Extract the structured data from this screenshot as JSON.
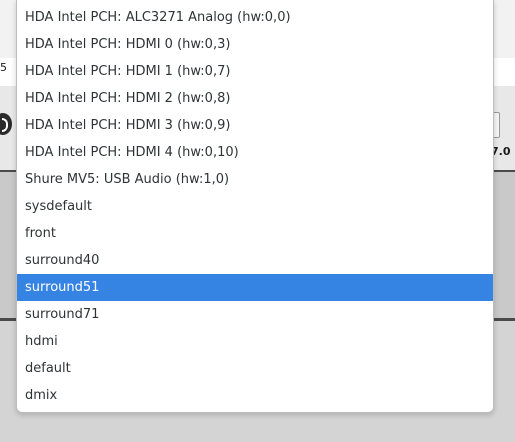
{
  "background": {
    "left_fragment": "5",
    "right_fragment": "7.0"
  },
  "dropdown": {
    "selected_index": 10,
    "selected_color": "#3584e4",
    "items": [
      {
        "label": "HDA Intel PCH: ALC3271 Analog (hw:0,0)"
      },
      {
        "label": "HDA Intel PCH: HDMI 0 (hw:0,3)"
      },
      {
        "label": "HDA Intel PCH: HDMI 1 (hw:0,7)"
      },
      {
        "label": "HDA Intel PCH: HDMI 2 (hw:0,8)"
      },
      {
        "label": "HDA Intel PCH: HDMI 3 (hw:0,9)"
      },
      {
        "label": "HDA Intel PCH: HDMI 4 (hw:0,10)"
      },
      {
        "label": "Shure MV5: USB Audio (hw:1,0)"
      },
      {
        "label": "sysdefault"
      },
      {
        "label": "front"
      },
      {
        "label": "surround40"
      },
      {
        "label": "surround51"
      },
      {
        "label": "surround71"
      },
      {
        "label": "hdmi"
      },
      {
        "label": "default"
      },
      {
        "label": "dmix"
      }
    ]
  }
}
